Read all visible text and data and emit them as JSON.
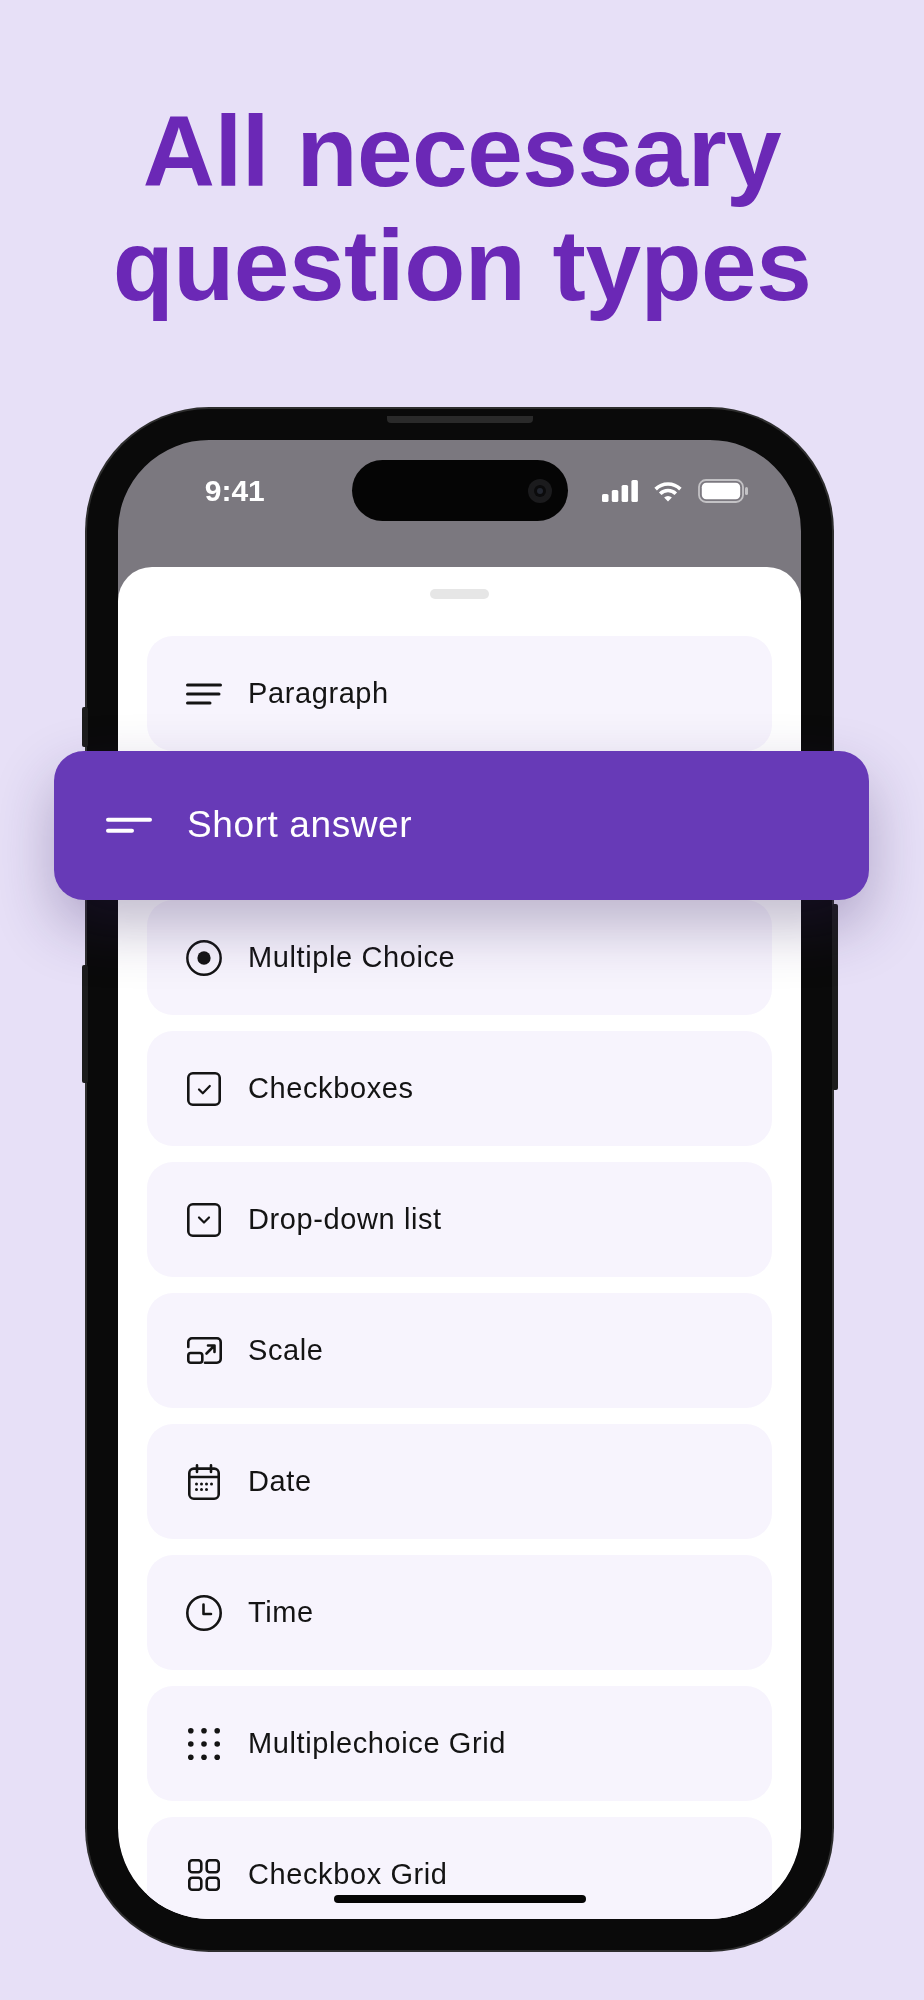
{
  "headline": "All necessary question types",
  "status_bar": {
    "time": "9:41"
  },
  "question_types": [
    {
      "kind": "paragraph",
      "label": "Paragraph",
      "selected": false
    },
    {
      "kind": "short-answer",
      "label": "Short answer",
      "selected": true
    },
    {
      "kind": "multiple-choice",
      "label": "Multiple Choice",
      "selected": false
    },
    {
      "kind": "checkboxes",
      "label": "Checkboxes",
      "selected": false
    },
    {
      "kind": "dropdown",
      "label": "Drop-down list",
      "selected": false
    },
    {
      "kind": "scale",
      "label": "Scale",
      "selected": false
    },
    {
      "kind": "date",
      "label": "Date",
      "selected": false
    },
    {
      "kind": "time",
      "label": "Time",
      "selected": false
    },
    {
      "kind": "multiple-choice-grid",
      "label": "Multiplechoice Grid",
      "selected": false
    },
    {
      "kind": "checkbox-grid",
      "label": "Checkbox Grid",
      "selected": false
    }
  ]
}
